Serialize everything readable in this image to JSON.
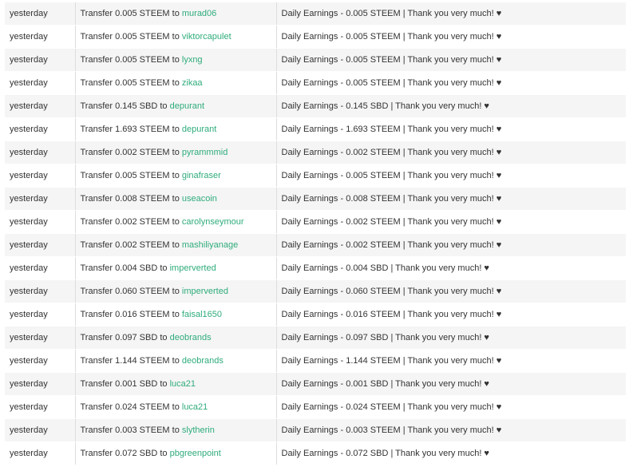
{
  "transfers": [
    {
      "when": "yesterday",
      "prefix": "Transfer 0.005 STEEM to",
      "to": "murad06",
      "memo": "Daily Earnings - 0.005 STEEM | Thank you very much! ♥"
    },
    {
      "when": "yesterday",
      "prefix": "Transfer 0.005 STEEM to",
      "to": "viktorcapulet",
      "memo": "Daily Earnings - 0.005 STEEM | Thank you very much! ♥"
    },
    {
      "when": "yesterday",
      "prefix": "Transfer 0.005 STEEM to",
      "to": "lyxng",
      "memo": "Daily Earnings - 0.005 STEEM | Thank you very much! ♥"
    },
    {
      "when": "yesterday",
      "prefix": "Transfer 0.005 STEEM to",
      "to": "zikaa",
      "memo": "Daily Earnings - 0.005 STEEM | Thank you very much! ♥"
    },
    {
      "when": "yesterday",
      "prefix": "Transfer 0.145 SBD to",
      "to": "depurant",
      "memo": "Daily Earnings - 0.145 SBD | Thank you very much! ♥"
    },
    {
      "when": "yesterday",
      "prefix": "Transfer 1.693 STEEM to",
      "to": "depurant",
      "memo": "Daily Earnings - 1.693 STEEM | Thank you very much! ♥"
    },
    {
      "when": "yesterday",
      "prefix": "Transfer 0.002 STEEM to",
      "to": "pyrammmid",
      "memo": "Daily Earnings - 0.002 STEEM | Thank you very much! ♥"
    },
    {
      "when": "yesterday",
      "prefix": "Transfer 0.005 STEEM to",
      "to": "ginafraser",
      "memo": "Daily Earnings - 0.005 STEEM | Thank you very much! ♥"
    },
    {
      "when": "yesterday",
      "prefix": "Transfer 0.008 STEEM to",
      "to": "useacoin",
      "memo": "Daily Earnings - 0.008 STEEM | Thank you very much! ♥"
    },
    {
      "when": "yesterday",
      "prefix": "Transfer 0.002 STEEM to",
      "to": "carolynseymour",
      "memo": "Daily Earnings - 0.002 STEEM | Thank you very much! ♥"
    },
    {
      "when": "yesterday",
      "prefix": "Transfer 0.002 STEEM to",
      "to": "mashiliyanage",
      "memo": "Daily Earnings - 0.002 STEEM | Thank you very much! ♥"
    },
    {
      "when": "yesterday",
      "prefix": "Transfer 0.004 SBD to",
      "to": "imperverted",
      "memo": "Daily Earnings - 0.004 SBD | Thank you very much! ♥"
    },
    {
      "when": "yesterday",
      "prefix": "Transfer 0.060 STEEM to",
      "to": "imperverted",
      "memo": "Daily Earnings - 0.060 STEEM | Thank you very much! ♥"
    },
    {
      "when": "yesterday",
      "prefix": "Transfer 0.016 STEEM to",
      "to": "faisal1650",
      "memo": "Daily Earnings - 0.016 STEEM | Thank you very much! ♥"
    },
    {
      "when": "yesterday",
      "prefix": "Transfer 0.097 SBD to",
      "to": "deobrands",
      "memo": "Daily Earnings - 0.097 SBD | Thank you very much! ♥"
    },
    {
      "when": "yesterday",
      "prefix": "Transfer 1.144 STEEM to",
      "to": "deobrands",
      "memo": "Daily Earnings - 1.144 STEEM | Thank you very much! ♥"
    },
    {
      "when": "yesterday",
      "prefix": "Transfer 0.001 SBD to",
      "to": "luca21",
      "memo": "Daily Earnings - 0.001 SBD | Thank you very much! ♥"
    },
    {
      "when": "yesterday",
      "prefix": "Transfer 0.024 STEEM to",
      "to": "luca21",
      "memo": "Daily Earnings - 0.024 STEEM | Thank you very much! ♥"
    },
    {
      "when": "yesterday",
      "prefix": "Transfer 0.003 STEEM to",
      "to": "slytherin",
      "memo": "Daily Earnings - 0.003 STEEM | Thank you very much! ♥"
    },
    {
      "when": "yesterday",
      "prefix": "Transfer 0.072 SBD to",
      "to": "pbgreenpoint",
      "memo": "Daily Earnings - 0.072 SBD | Thank you very much! ♥"
    }
  ],
  "colors": {
    "link": "#2fac7c",
    "row_alt": "#f5f5f5",
    "text": "#333333"
  }
}
